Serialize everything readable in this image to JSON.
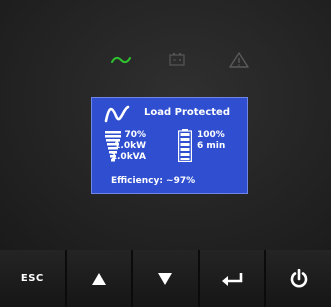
{
  "indicators": [
    {
      "name": "line-power-icon",
      "color": "#2ec42e"
    },
    {
      "name": "battery-icon",
      "color": "#555555"
    },
    {
      "name": "alarm-icon",
      "color": "#555555"
    }
  ],
  "lcd": {
    "background": "#2f4fd0",
    "status": "Load Protected",
    "load_percent": "70%",
    "load_kw": "1.0kW",
    "load_kva": "1.0kVA",
    "battery_percent": "100%",
    "battery_runtime": "6 min",
    "efficiency": "Efficiency: ~97%"
  },
  "buttons": [
    {
      "id": "esc",
      "label": "ESC"
    },
    {
      "id": "up",
      "icon": "up-arrow-icon"
    },
    {
      "id": "down",
      "icon": "down-arrow-icon"
    },
    {
      "id": "enter",
      "icon": "enter-icon"
    },
    {
      "id": "power",
      "icon": "power-icon"
    }
  ]
}
